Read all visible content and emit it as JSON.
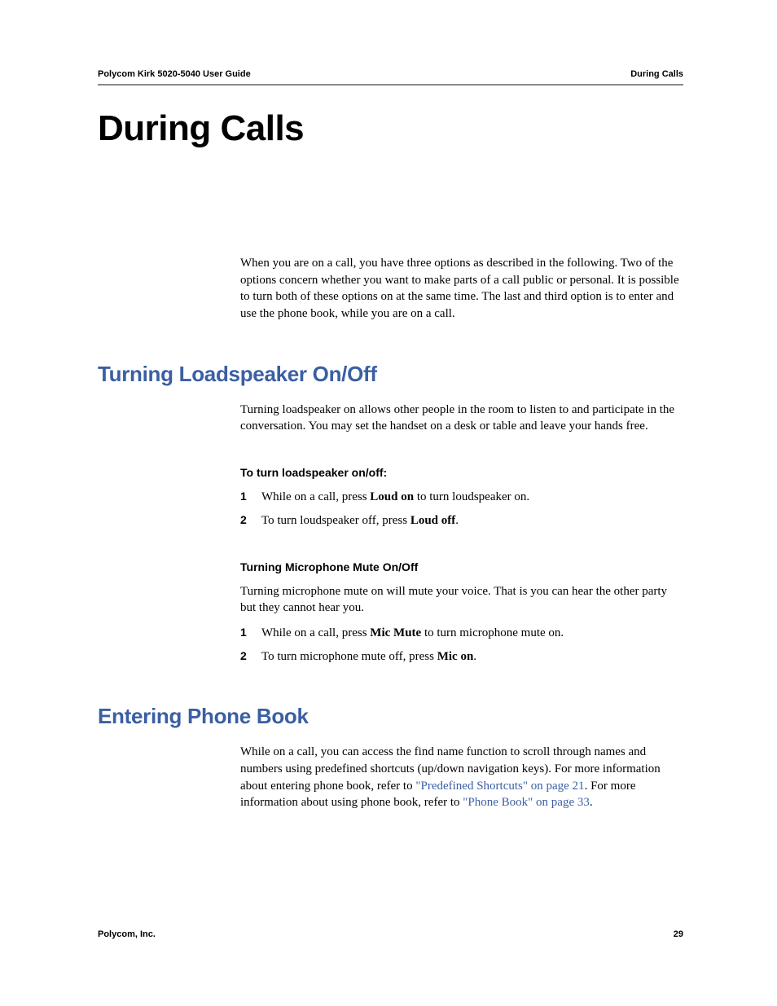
{
  "header": {
    "left": "Polycom Kirk 5020-5040 User Guide",
    "right": "During Calls"
  },
  "chapter_title": "During Calls",
  "intro_para": "When you are on a call, you have three options as described in the following. Two of the options concern whether you want to make parts of a call public or personal. It is possible to turn both of these options on at the same time. The last and third option is to enter and use the phone book, while you are on a call.",
  "section1": {
    "heading": "Turning Loadspeaker On/Off",
    "para": "Turning loadspeaker on allows other people in the room to listen to and participate in the conversation. You may set the handset on a desk or table and leave your hands free.",
    "sub1_heading": "To turn loadspeaker on/off:",
    "sub1_items": [
      {
        "num": "1",
        "pre": "While on a call, press ",
        "bold": "Loud on",
        "post": " to turn loudspeaker on."
      },
      {
        "num": "2",
        "pre": "To turn loudspeaker off, press ",
        "bold": "Loud off",
        "post": "."
      }
    ],
    "sub2_heading": "Turning Microphone Mute On/Off",
    "sub2_para": "Turning microphone mute on will mute your voice. That is you can hear the other party but they cannot hear you.",
    "sub2_items": [
      {
        "num": "1",
        "pre": "While on a call, press ",
        "bold": "Mic Mute",
        "post": " to turn microphone mute on."
      },
      {
        "num": "2",
        "pre": "To turn microphone mute off, press ",
        "bold": "Mic on",
        "post": "."
      }
    ]
  },
  "section2": {
    "heading": "Entering Phone Book",
    "para_pre": "While on a call, you can access the find name function to scroll through names and numbers using predefined shortcuts (up/down navigation keys). For more information about entering phone book, refer to ",
    "link1": "\"Predefined Shortcuts\" on page 21",
    "para_mid": ". For more information about using phone book, refer to ",
    "link2": "\"Phone Book\" on page 33",
    "para_post": "."
  },
  "footer": {
    "left": "Polycom, Inc.",
    "right": "29"
  }
}
